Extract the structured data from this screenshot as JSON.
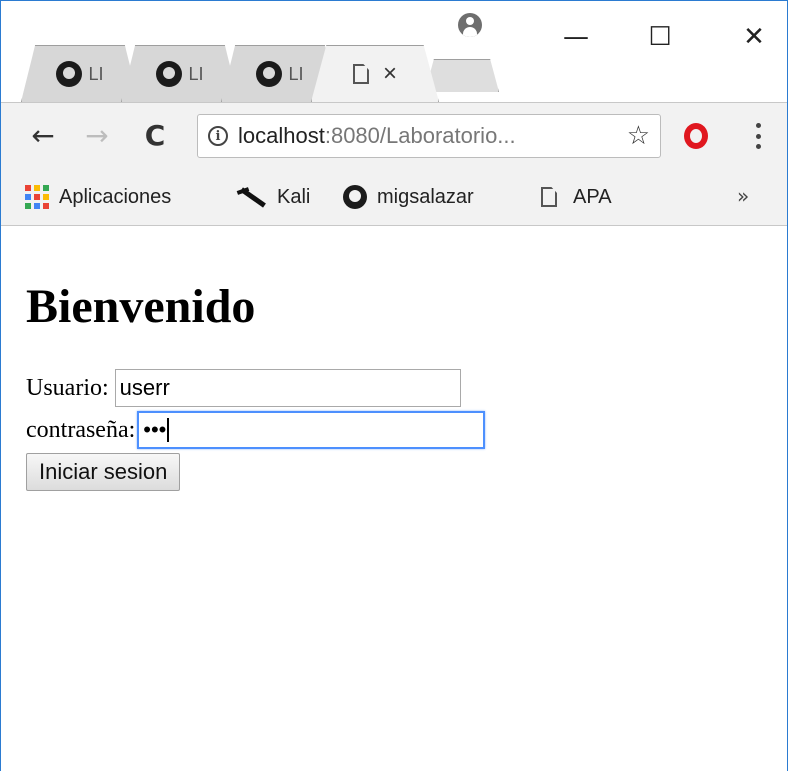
{
  "browser": {
    "tabs": [
      {
        "label": "LI",
        "icon": "github-icon"
      },
      {
        "label": "LI",
        "icon": "github-icon"
      },
      {
        "label": "LI",
        "icon": "github-icon"
      },
      {
        "label": "",
        "icon": "page-icon",
        "close": "×",
        "active": true
      }
    ],
    "window_controls": {
      "minimize": "—",
      "maximize": "☐",
      "close": "✕"
    },
    "nav": {
      "back": "←",
      "forward": "→",
      "reload": "C"
    },
    "omnibox": {
      "info_icon": "i",
      "host": "localhost",
      "rest": ":8080/Laboratorio...",
      "star": "☆"
    },
    "bookmarks": [
      {
        "label": "Aplicaciones",
        "icon": "apps-grid-icon"
      },
      {
        "label": "Kali",
        "icon": "kali-icon"
      },
      {
        "label": "migsalazar",
        "icon": "github-icon"
      },
      {
        "label": "APA",
        "icon": "page-icon"
      }
    ],
    "bookmarks_overflow": "»",
    "apps_colors": [
      "#ea4335",
      "#fbbc05",
      "#34a853",
      "#4285f4",
      "#ea4335",
      "#fbbc05",
      "#34a853",
      "#4285f4",
      "#ea4335"
    ]
  },
  "page": {
    "heading": "Bienvenido",
    "form": {
      "user_label": "Usuario:",
      "user_value": "userr",
      "password_label": "contraseña:",
      "password_value": "•••",
      "submit_label": "Iniciar sesion"
    }
  }
}
